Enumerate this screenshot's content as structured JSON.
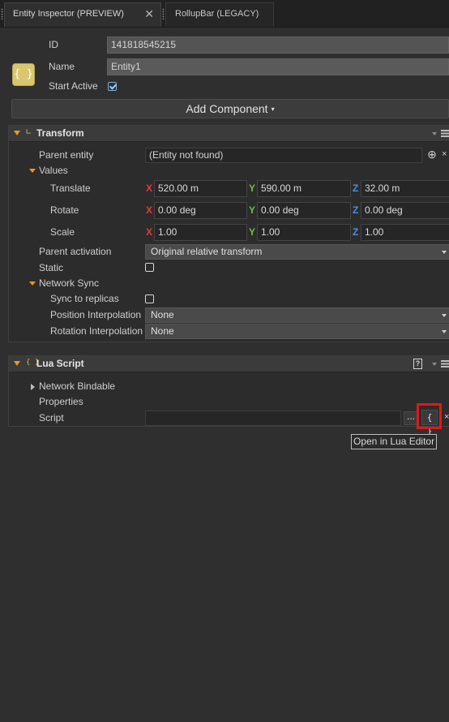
{
  "tabs": [
    {
      "label": "Entity Inspector (PREVIEW)",
      "close": "✕",
      "active": true
    },
    {
      "label": "RollupBar (LEGACY)",
      "active": false
    }
  ],
  "entity": {
    "icon": "{ }",
    "id_label": "ID",
    "id_value": "141818545215",
    "name_label": "Name",
    "name_value": "Entity1",
    "start_active_label": "Start Active",
    "start_active": true
  },
  "add_component": {
    "label": "Add Component",
    "caret": "▾"
  },
  "transform": {
    "title": "Transform",
    "icon": "∟",
    "parent_entity_label": "Parent entity",
    "parent_entity_value": "(Entity not found)",
    "values_label": "Values",
    "axes": {
      "x": "X",
      "y": "Y",
      "z": "Z"
    },
    "translate": {
      "label": "Translate",
      "x": "520.00 m",
      "y": "590.00 m",
      "z": "32.00 m"
    },
    "rotate": {
      "label": "Rotate",
      "x": "0.00 deg",
      "y": "0.00 deg",
      "z": "0.00 deg"
    },
    "scale": {
      "label": "Scale",
      "x": "1.00",
      "y": "1.00",
      "z": "1.00"
    },
    "parent_activation_label": "Parent activation",
    "parent_activation_value": "Original relative transform",
    "static_label": "Static",
    "static": false,
    "network_sync_label": "Network Sync",
    "sync_to_replicas_label": "Sync to replicas",
    "sync_to_replicas": false,
    "position_interp_label": "Position Interpolation",
    "position_interp_value": "None",
    "rotation_interp_label": "Rotation Interpolation",
    "rotation_interp_value": "None"
  },
  "lua_script": {
    "title": "Lua Script",
    "icon": "{ }",
    "help": "?",
    "network_bindable_label": "Network Bindable",
    "properties_label": "Properties",
    "script_label": "Script",
    "script_value": "",
    "browse_label": "...",
    "editor_button_label": "{ }",
    "clear_label": "×",
    "tooltip": "Open in Lua Editor"
  },
  "colors": {
    "accent_orange": "#e39a2a",
    "axis_x": "#e23b3b",
    "axis_y": "#6ac245",
    "axis_z": "#4a8fe2",
    "highlight": "#e01818"
  }
}
